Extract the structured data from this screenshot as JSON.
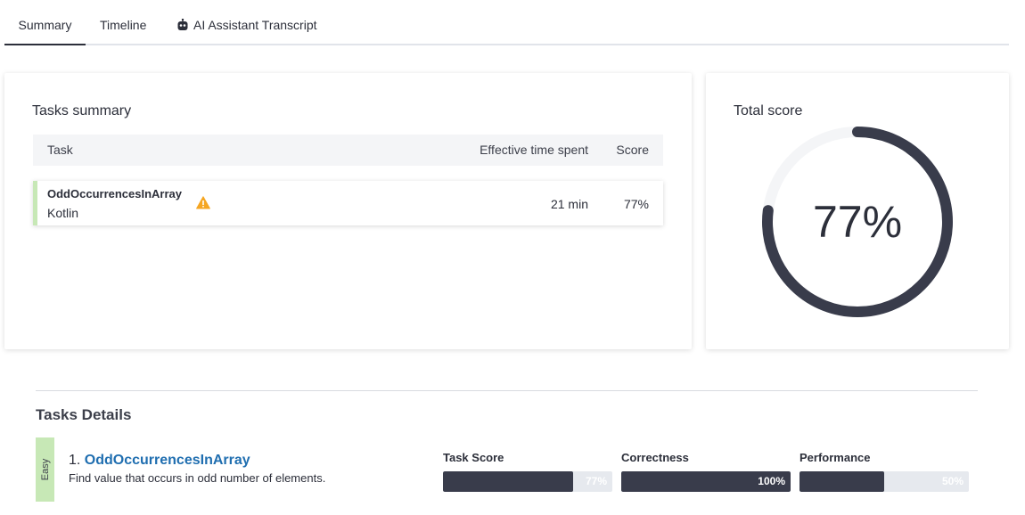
{
  "tabs": [
    {
      "label": "Summary",
      "active": true
    },
    {
      "label": "Timeline",
      "active": false
    },
    {
      "label": "AI Assistant Transcript",
      "active": false,
      "icon": "robot-icon"
    }
  ],
  "tasks_summary": {
    "title": "Tasks summary",
    "columns": [
      "Task",
      "Effective time spent",
      "Score"
    ],
    "rows": [
      {
        "name": "OddOccurrencesInArray",
        "language": "Kotlin",
        "time": "21 min",
        "score": "77%",
        "warning_icon": "warning-icon"
      }
    ]
  },
  "total_score": {
    "title": "Total score",
    "value_text": "77%",
    "value": 77
  },
  "details": {
    "title": "Tasks Details",
    "tasks": [
      {
        "difficulty": "Easy",
        "number": "1.",
        "name": "OddOccurrencesInArray",
        "description": "Find value that occurs in odd number of elements.",
        "metrics": [
          {
            "label": "Task Score",
            "text": "77%",
            "value": 77
          },
          {
            "label": "Correctness",
            "text": "100%",
            "value": 100
          },
          {
            "label": "Performance",
            "text": "50%",
            "value": 50
          }
        ]
      }
    ]
  },
  "colors": {
    "accent_dark": "#393c4b",
    "easy_green": "#c7e8b6",
    "link_blue": "#1f6eb0",
    "warning": "#f5a623"
  }
}
